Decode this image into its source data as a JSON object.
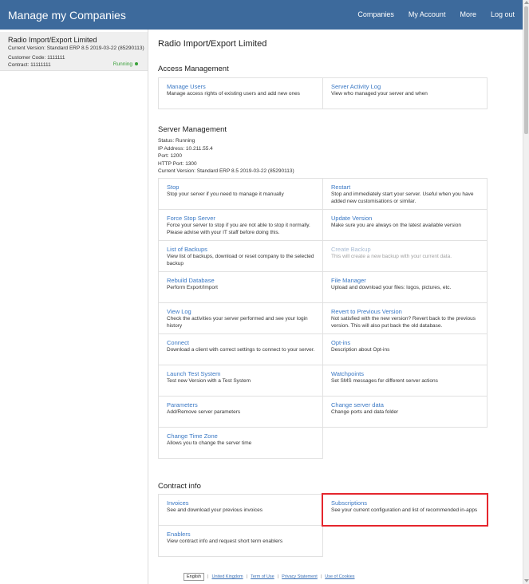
{
  "header": {
    "title": "Manage my Companies",
    "nav": [
      "Companies",
      "My Account",
      "More",
      "Log out"
    ]
  },
  "sidebar": {
    "company_name": "Radio Import/Export Limited",
    "current_version": "Current Version: Standard ERP 8.5 2019-03-22 (85290113)",
    "customer_code": "Customer Code: 1111111",
    "contract": "Contract: 11111111",
    "status": "Running"
  },
  "main": {
    "title": "Radio Import/Export Limited",
    "access": {
      "title": "Access Management",
      "cells": [
        {
          "title": "Manage Users",
          "desc": "Manage access rights of existing users and add new ones"
        },
        {
          "title": "Server Activity Log",
          "desc": "View who managed your server and when"
        }
      ]
    },
    "server": {
      "title": "Server Management",
      "info": [
        "Status: Running",
        "IP Address: 10.211.55.4",
        "Port: 1200",
        "HTTP Port: 1300",
        "Current Version: Standard ERP 8.5 2019-03-22 (85290113)"
      ],
      "cells": [
        {
          "title": "Stop",
          "desc": "Stop your server if you need to manage it manually"
        },
        {
          "title": "Restart",
          "desc": "Stop and immediately start your server. Useful when you have added new customisations or similar."
        },
        {
          "title": "Force Stop Server",
          "desc": "Force your server to stop if you are not able to stop it normally. Please advise with your IT staff before doing this."
        },
        {
          "title": "Update Version",
          "desc": "Make sure you are always on the latest available version"
        },
        {
          "title": "List of Backups",
          "desc": "View list of backups, download or reset company to the selected backup"
        },
        {
          "title": "Create Backup",
          "desc": "This will create a new backup with your current data."
        },
        {
          "title": "Rebuild Database",
          "desc": "Perform Export/Import"
        },
        {
          "title": "File Manager",
          "desc": "Upload and download your files: logos, pictures, etc."
        },
        {
          "title": "View Log",
          "desc": "Check the activities your server performed and see your login history"
        },
        {
          "title": "Revert to Previous Version",
          "desc": "Not satisfied with the new version? Revert back to the previous version. This will also put back the old database."
        },
        {
          "title": "Connect",
          "desc": "Download a client with correct settings to connect to your server."
        },
        {
          "title": "Opt-ins",
          "desc": "Description about Opt-ins"
        },
        {
          "title": "Launch Test System",
          "desc": "Test new Version with a Test System"
        },
        {
          "title": "Watchpoints",
          "desc": "Set SMS messages for different server actions"
        },
        {
          "title": "Parameters",
          "desc": "Add/Remove server parameters"
        },
        {
          "title": "Change server data",
          "desc": "Change ports and data folder"
        },
        {
          "title": "Change Time Zone",
          "desc": "Allows you to change the server time"
        }
      ]
    },
    "contract": {
      "title": "Contract info",
      "cells": [
        {
          "title": "Invoices",
          "desc": "See and download your previous invoices"
        },
        {
          "title": "Subscriptions",
          "desc": "See your current configuration and list of recommended in-apps"
        },
        {
          "title": "Enablers",
          "desc": "View contract info and request short term enablers"
        }
      ]
    }
  },
  "footer": {
    "language": "English",
    "links": [
      "United Kingdom",
      "Term of Use",
      "Privacy Statement",
      "Use of Cookies"
    ]
  },
  "colors": {
    "header_bg": "#3d6a9c",
    "link": "#3a78c4",
    "running": "#3aa13a",
    "highlight": "#e5262d"
  }
}
